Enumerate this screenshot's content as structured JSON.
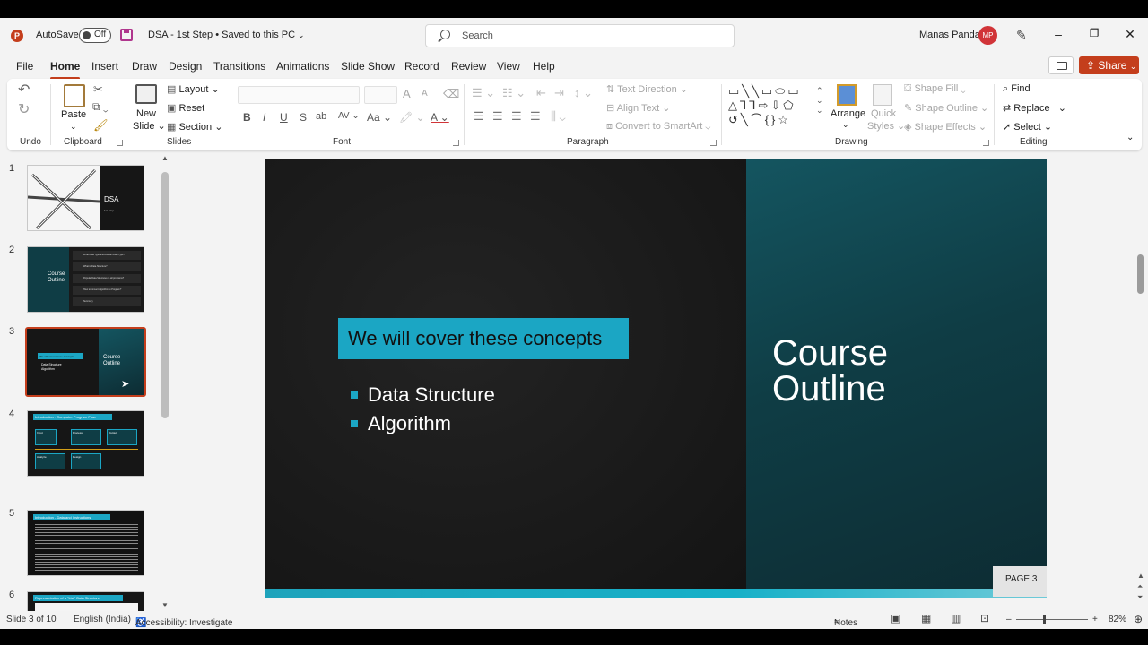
{
  "titlebar": {
    "logo": "P",
    "autosave_label": "AutoSave",
    "autosave_state": "Off",
    "doc_title": "DSA - 1st Step • Saved to this PC",
    "search_placeholder": "Search",
    "user_name": "Manas Panda",
    "user_initials": "MP"
  },
  "tabs": [
    "File",
    "Home",
    "Insert",
    "Draw",
    "Design",
    "Transitions",
    "Animations",
    "Slide Show",
    "Record",
    "Review",
    "View",
    "Help"
  ],
  "active_tab": "Home",
  "share_label": "Share",
  "ribbon": {
    "undo_group": "Undo",
    "clipboard": {
      "paste": "Paste",
      "group": "Clipboard"
    },
    "slides": {
      "new_slide_1": "New",
      "new_slide_2": "Slide",
      "layout": "Layout",
      "reset": "Reset",
      "section": "Section",
      "group": "Slides"
    },
    "font": {
      "group": "Font",
      "bold": "B",
      "italic": "I",
      "underline": "U",
      "strike": "S",
      "shadow": "ab",
      "case": "Aa",
      "grow": "A",
      "shrink": "A"
    },
    "paragraph": {
      "group": "Paragraph",
      "text_direction": "Text Direction",
      "align_text": "Align Text",
      "convert_smartart": "Convert to SmartArt"
    },
    "drawing": {
      "group": "Drawing",
      "arrange": "Arrange",
      "quick_styles_1": "Quick",
      "quick_styles_2": "Styles",
      "shape_fill": "Shape Fill",
      "shape_outline": "Shape Outline",
      "shape_effects": "Shape Effects"
    },
    "editing": {
      "group": "Editing",
      "find": "Find",
      "replace": "Replace",
      "select": "Select"
    }
  },
  "thumbnails": [
    {
      "num": "1",
      "title": "DSA",
      "subtitle": "1st Step"
    },
    {
      "num": "2",
      "title_1": "Course",
      "title_2": "Outline",
      "items": [
        "What Data Type and Abstract Data Type?",
        "What is Data Structure?",
        "Popular Data Structures in all programs?",
        "How to convert Algorithm to Program?",
        "Summary"
      ]
    },
    {
      "num": "3",
      "heading": "We will cover these concepts",
      "bullets": [
        "Data Structure",
        "Algorithm"
      ],
      "title_1": "Course",
      "title_2": "Outline"
    },
    {
      "num": "4",
      "heading": "Introduction : Computer Program Flow",
      "boxes": [
        "Input",
        "Process",
        "Output",
        "Analyze",
        "Design"
      ]
    },
    {
      "num": "5",
      "heading": "Introduction - Data and Instructions"
    },
    {
      "num": "6",
      "heading": "Representation of a \"List\" Data Structure"
    }
  ],
  "slide": {
    "heading": "We will cover these concepts",
    "bullets": [
      "Data Structure",
      "Algorithm"
    ],
    "title_line1": "Course",
    "title_line2": "Outline",
    "page": "PAGE 3"
  },
  "status": {
    "slide_of": "Slide 3 of 10",
    "language": "English (India)",
    "accessibility": "Accessibility: Investigate",
    "notes": "Notes",
    "zoom": "82%"
  },
  "colors": {
    "accent": "#c43e1c",
    "slide_teal": "#1ba6c4",
    "slide_dark": "#1b1b1b"
  }
}
